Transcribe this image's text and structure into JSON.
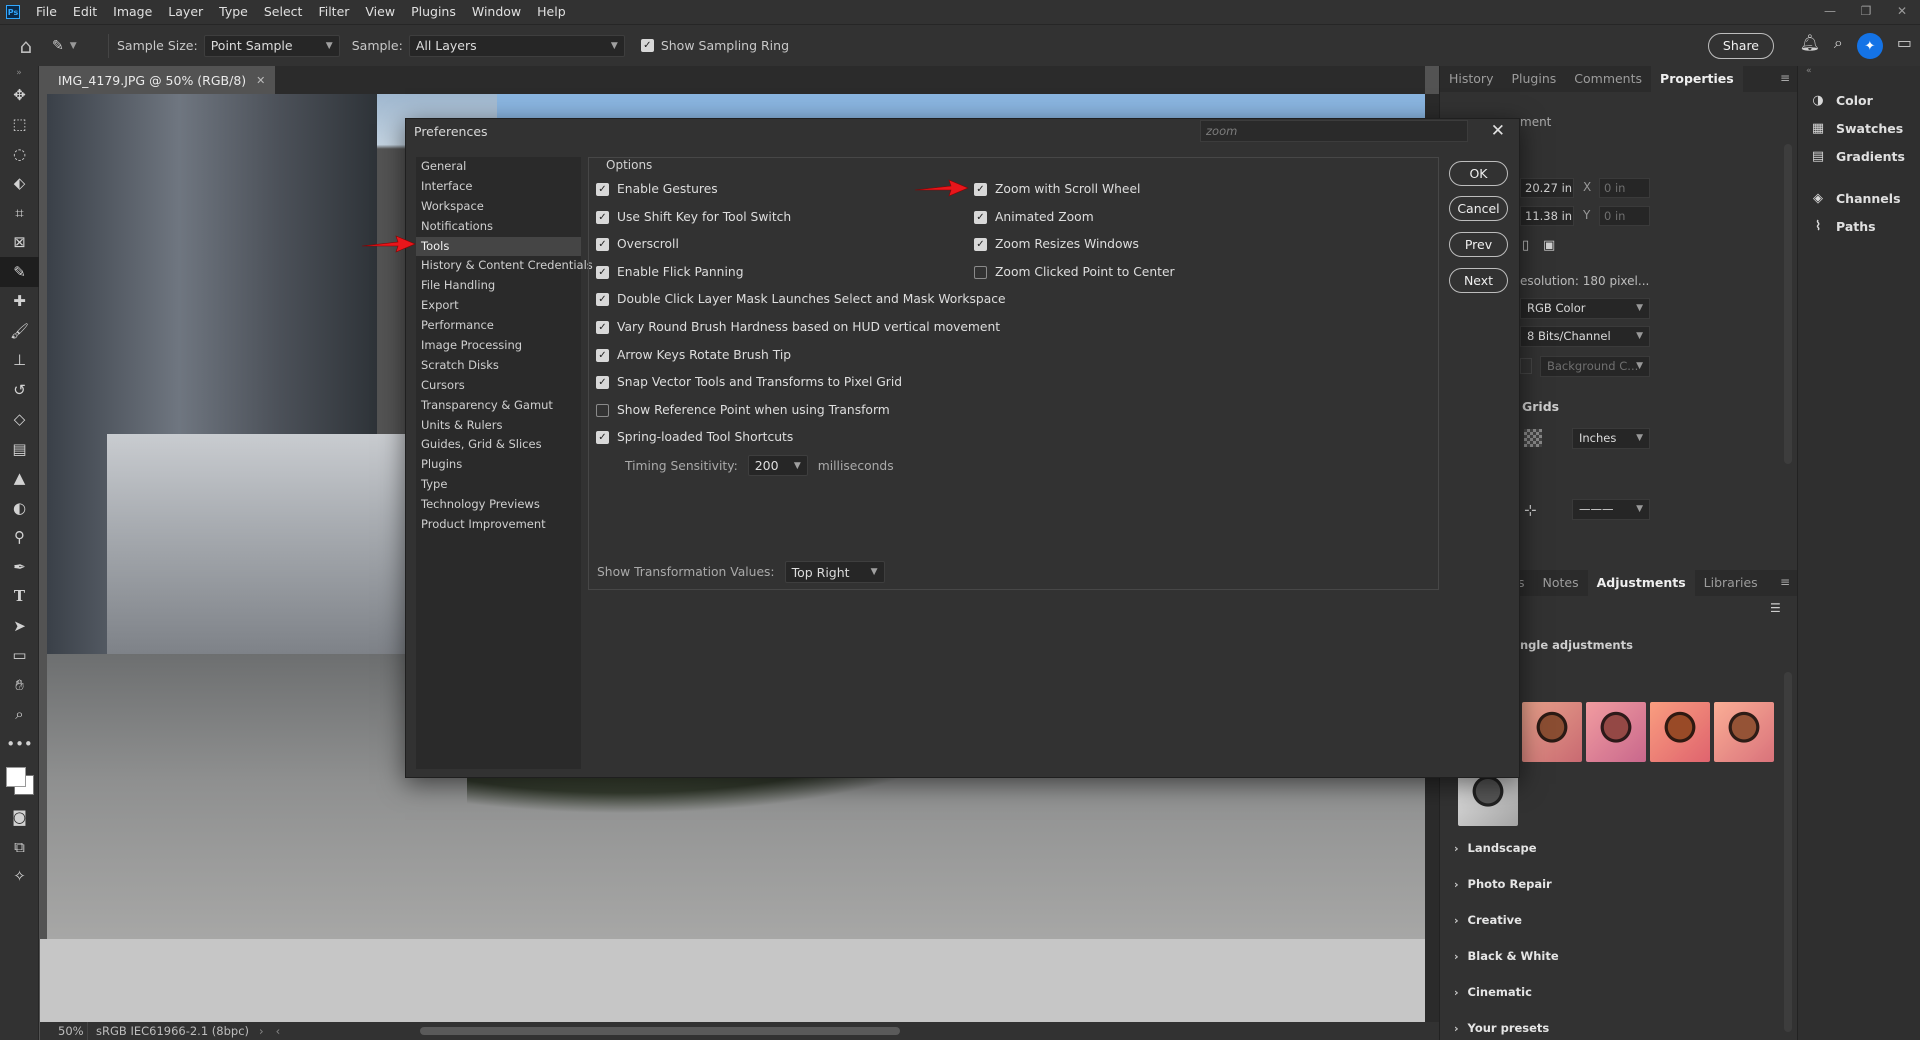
{
  "menubar": {
    "app_icon": "Ps",
    "items": [
      "File",
      "Edit",
      "Image",
      "Layer",
      "Type",
      "Select",
      "Filter",
      "View",
      "Plugins",
      "Window",
      "Help"
    ],
    "window_controls": [
      "—",
      "❐",
      "✕"
    ]
  },
  "optionsbar": {
    "sample_size_label": "Sample Size:",
    "sample_size_value": "Point Sample",
    "sample_label": "Sample:",
    "sample_value": "All Layers",
    "show_sampling_ring_label": "Show Sampling Ring",
    "show_sampling_ring_checked": true,
    "share_label": "Share"
  },
  "document": {
    "tab_title": "IMG_4179.JPG @ 50% (RGB/8)",
    "zoom": "50%",
    "profile": "sRGB IEC61966-2.1 (8bpc)"
  },
  "properties_panel": {
    "tabs": [
      "History",
      "Plugins",
      "Comments",
      "Properties"
    ],
    "active_tab": "Properties",
    "header_partial": "ment",
    "width_value": "20.27 in",
    "height_value": "11.38 in",
    "x_label": "X",
    "y_label": "Y",
    "x_value": "0 in",
    "y_value": "0 in",
    "resolution_text": "esolution: 180 pixel...",
    "mode": "RGB Color",
    "depth": "8 Bits/Channel",
    "fill": "Background C...",
    "grids_heading": "Grids",
    "grids_units": "Inches"
  },
  "adjustments_panel": {
    "tabs": [
      "s",
      "Notes",
      "Adjustments",
      "Libraries"
    ],
    "active_tab": "Adjustments",
    "subtitle": "ngle adjustments",
    "categories": [
      "Landscape",
      "Photo Repair",
      "Creative",
      "Black & White",
      "Cinematic",
      "Your presets"
    ]
  },
  "side_panels": [
    {
      "icon": "color-wheel-icon",
      "label": "Color"
    },
    {
      "icon": "swatches-grid-icon",
      "label": "Swatches"
    },
    {
      "icon": "gradient-icon",
      "label": "Gradients"
    },
    {
      "icon": "channels-icon",
      "label": "Channels"
    },
    {
      "icon": "paths-icon",
      "label": "Paths"
    }
  ],
  "preferences": {
    "title": "Preferences",
    "search_placeholder": "zoom",
    "nav": [
      "General",
      "Interface",
      "Workspace",
      "Notifications",
      "Tools",
      "History & Content Credentials",
      "File Handling",
      "Export",
      "Performance",
      "Image Processing",
      "Scratch Disks",
      "Cursors",
      "Transparency & Gamut",
      "Units & Rulers",
      "Guides, Grid & Slices",
      "Plugins",
      "Type",
      "Technology Previews",
      "Product Improvement"
    ],
    "selected_nav": "Tools",
    "options_label": "Options",
    "left_options": [
      {
        "label": "Enable Gestures",
        "checked": true
      },
      {
        "label": "Use Shift Key for Tool Switch",
        "checked": true
      },
      {
        "label": "Overscroll",
        "checked": true
      },
      {
        "label": "Enable Flick Panning",
        "checked": true
      },
      {
        "label": "Double Click Layer Mask Launches Select and Mask Workspace",
        "checked": true
      },
      {
        "label": "Vary Round Brush Hardness based on HUD vertical movement",
        "checked": true
      },
      {
        "label": "Arrow Keys Rotate Brush Tip",
        "checked": true
      },
      {
        "label": "Snap Vector Tools and Transforms to Pixel Grid",
        "checked": true
      },
      {
        "label": "Show Reference Point when using Transform",
        "checked": false
      },
      {
        "label": "Spring-loaded Tool Shortcuts",
        "checked": true
      }
    ],
    "right_options": [
      {
        "label": "Zoom with Scroll Wheel",
        "checked": true
      },
      {
        "label": "Animated Zoom",
        "checked": true
      },
      {
        "label": "Zoom Resizes Windows",
        "checked": true
      },
      {
        "label": "Zoom Clicked Point to Center",
        "checked": false
      }
    ],
    "timing_label": "Timing Sensitivity:",
    "timing_value": "200",
    "timing_unit": "milliseconds",
    "transform_values_label": "Show Transformation Values:",
    "transform_values_value": "Top Right",
    "buttons": {
      "ok": "OK",
      "cancel": "Cancel",
      "prev": "Prev",
      "next": "Next"
    }
  },
  "colors": {
    "annotation_arrow": "#e8161b",
    "accent": "#1473e6"
  }
}
